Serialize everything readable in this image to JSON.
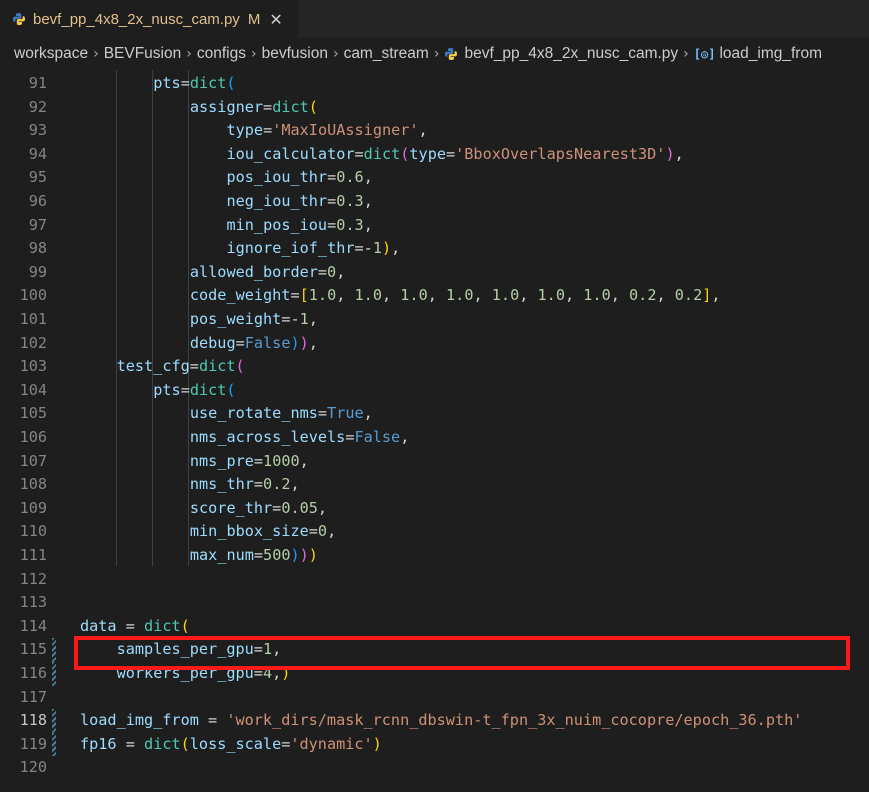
{
  "tab": {
    "filename": "bevf_pp_4x8_2x_nusc_cam.py",
    "modified": "M",
    "close": "✕"
  },
  "breadcrumb": [
    "workspace",
    "BEVFusion",
    "configs",
    "bevfusion",
    "cam_stream",
    "bevf_pp_4x8_2x_nusc_cam.py",
    "load_img_from"
  ],
  "lines": [
    {
      "n": "91",
      "t": "        pts=dict("
    },
    {
      "n": "92",
      "t": "            assigner=dict("
    },
    {
      "n": "93",
      "t": "                type='MaxIoUAssigner',"
    },
    {
      "n": "94",
      "t": "                iou_calculator=dict(type='BboxOverlapsNearest3D'),"
    },
    {
      "n": "95",
      "t": "                pos_iou_thr=0.6,"
    },
    {
      "n": "96",
      "t": "                neg_iou_thr=0.3,"
    },
    {
      "n": "97",
      "t": "                min_pos_iou=0.3,"
    },
    {
      "n": "98",
      "t": "                ignore_iof_thr=-1),"
    },
    {
      "n": "99",
      "t": "            allowed_border=0,"
    },
    {
      "n": "100",
      "t": "            code_weight=[1.0, 1.0, 1.0, 1.0, 1.0, 1.0, 1.0, 0.2, 0.2],"
    },
    {
      "n": "101",
      "t": "            pos_weight=-1,"
    },
    {
      "n": "102",
      "t": "            debug=False)),"
    },
    {
      "n": "103",
      "t": "    test_cfg=dict("
    },
    {
      "n": "104",
      "t": "        pts=dict("
    },
    {
      "n": "105",
      "t": "            use_rotate_nms=True,"
    },
    {
      "n": "106",
      "t": "            nms_across_levels=False,"
    },
    {
      "n": "107",
      "t": "            nms_pre=1000,"
    },
    {
      "n": "108",
      "t": "            nms_thr=0.2,"
    },
    {
      "n": "109",
      "t": "            score_thr=0.05,"
    },
    {
      "n": "110",
      "t": "            min_bbox_size=0,"
    },
    {
      "n": "111",
      "t": "            max_num=500)))"
    },
    {
      "n": "112",
      "t": ""
    },
    {
      "n": "113",
      "t": ""
    },
    {
      "n": "114",
      "t": "data = dict("
    },
    {
      "n": "115",
      "t": "    samples_per_gpu=1,"
    },
    {
      "n": "116",
      "t": "    workers_per_gpu=4,)"
    },
    {
      "n": "117",
      "t": ""
    },
    {
      "n": "118",
      "t": "load_img_from = 'work_dirs/mask_rcnn_dbswin-t_fpn_3x_nuim_cocopre/epoch_36.pth'"
    },
    {
      "n": "119",
      "t": "fp16 = dict(loss_scale='dynamic')"
    },
    {
      "n": "120",
      "t": ""
    }
  ],
  "active_line": "118",
  "colors": {
    "highlight_box": "#ff1a1a",
    "background": "#1e1e1e"
  }
}
